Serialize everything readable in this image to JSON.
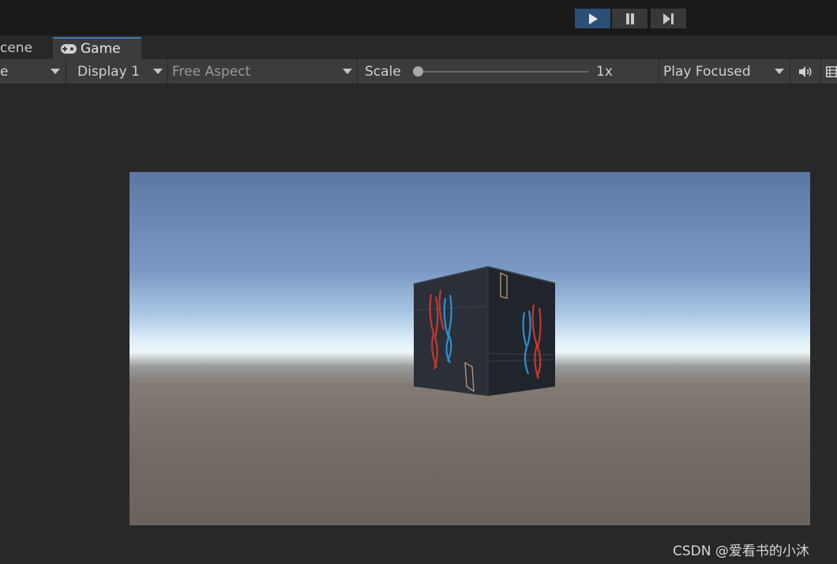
{
  "playback": {
    "play_icon": "play-icon",
    "pause_icon": "pause-icon",
    "step_icon": "step-icon",
    "active_color": "#2b4f77"
  },
  "tabs": {
    "scene": "cene",
    "game": "Game",
    "game_icon": "gamepad-icon"
  },
  "toolbar": {
    "left_dropdown": "e",
    "display": "Display 1",
    "aspect": "Free Aspect",
    "scale_label": "Scale",
    "scale_value": "1x",
    "scale_level": 0,
    "play_mode": "Play Focused",
    "audio_icon": "speaker-icon",
    "stats_icon": "grid-icon"
  },
  "watermark": "CSDN @爱看书的小沐"
}
